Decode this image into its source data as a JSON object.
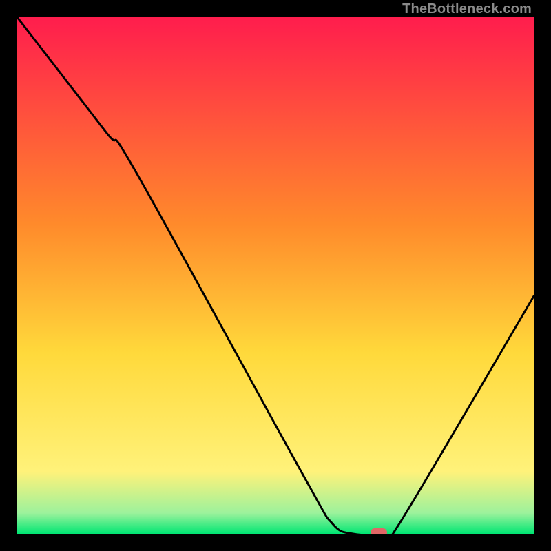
{
  "watermark": "TheBottleneck.com",
  "chart_data": {
    "type": "line",
    "title": "",
    "xlabel": "",
    "ylabel": "",
    "xlim": [
      0,
      100
    ],
    "ylim": [
      0,
      100
    ],
    "background_gradient": {
      "stops": [
        {
          "y": 100,
          "color": "#ff1d4d"
        },
        {
          "y": 60,
          "color": "#ff8a2b"
        },
        {
          "y": 35,
          "color": "#ffd93b"
        },
        {
          "y": 12,
          "color": "#fff27a"
        },
        {
          "y": 4,
          "color": "#9cf29c"
        },
        {
          "y": 0,
          "color": "#00e673"
        }
      ]
    },
    "series": [
      {
        "name": "bottleneck-curve",
        "color": "#000000",
        "points": [
          {
            "x": 0,
            "y": 100
          },
          {
            "x": 17,
            "y": 78
          },
          {
            "x": 23,
            "y": 70
          },
          {
            "x": 55,
            "y": 12
          },
          {
            "x": 61,
            "y": 2
          },
          {
            "x": 65,
            "y": 0
          },
          {
            "x": 71,
            "y": 0
          },
          {
            "x": 74,
            "y": 2
          },
          {
            "x": 100,
            "y": 46
          }
        ]
      }
    ],
    "marker": {
      "name": "optimal-point",
      "x": 70,
      "y": 0,
      "color": "#e06666",
      "shape": "rounded-rect"
    }
  }
}
